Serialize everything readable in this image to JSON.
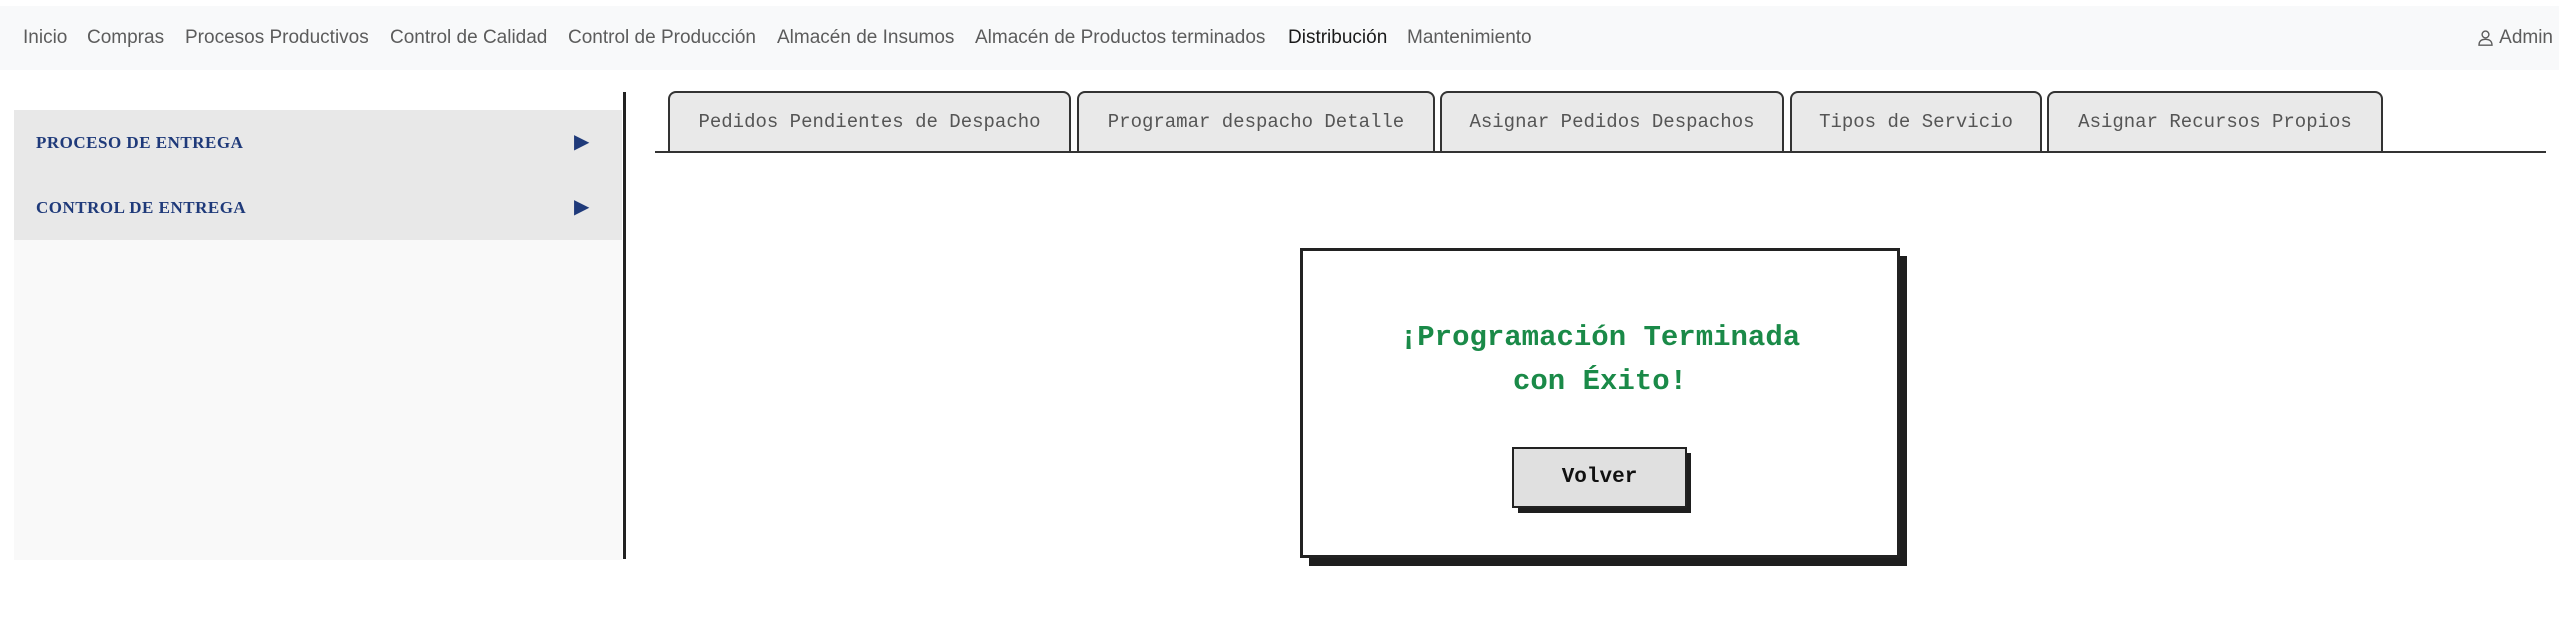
{
  "navbar": {
    "items": [
      {
        "label": "Inicio"
      },
      {
        "label": "Compras"
      },
      {
        "label": "Procesos Productivos"
      },
      {
        "label": "Control de Calidad"
      },
      {
        "label": "Control de Producción"
      },
      {
        "label": "Almacén de Insumos"
      },
      {
        "label": "Almacén de Productos terminados"
      },
      {
        "label": "Distribución"
      },
      {
        "label": "Mantenimiento"
      }
    ],
    "active_item": "Distribución",
    "user_label": "Admin",
    "user_icon": "user-icon"
  },
  "sidebar": {
    "items": [
      {
        "label": "PROCESO DE ENTREGA",
        "arrow": "▶"
      },
      {
        "label": "CONTROL DE ENTREGA",
        "arrow": "▶"
      }
    ]
  },
  "tabs": [
    {
      "label": "Pedidos Pendientes de Despacho"
    },
    {
      "label": "Programar despacho Detalle"
    },
    {
      "label": "Asignar Pedidos Despachos"
    },
    {
      "label": "Tipos de Servicio"
    },
    {
      "label": "Asignar Recursos Propios"
    }
  ],
  "dialog": {
    "title_line1": "¡Programación Terminada",
    "title_line2": "con Éxito!",
    "button_label": "Volver"
  },
  "colors": {
    "navbar_bg": "#f8f9fa",
    "sidebar_text": "#1f3a7a",
    "success_text": "#1a8a48",
    "tab_bg": "#e9e9e9",
    "button_bg": "#e0e0e0"
  }
}
